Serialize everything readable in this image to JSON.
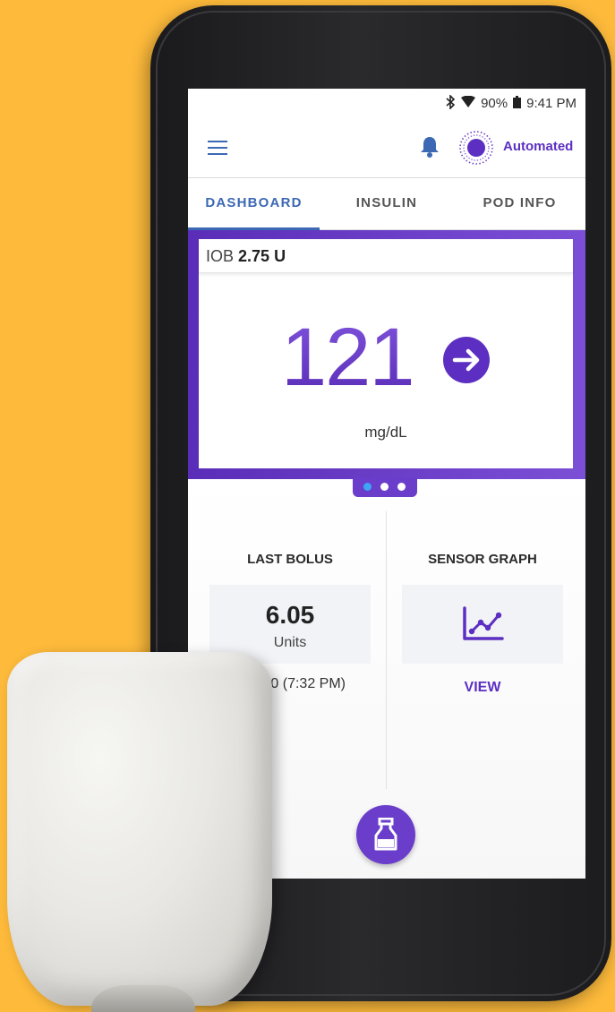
{
  "status_bar": {
    "bluetooth_icon": "bluetooth-icon",
    "wifi_icon": "wifi-icon",
    "battery_percent": "90%",
    "battery_icon": "battery-icon",
    "time": "9:41 PM"
  },
  "app_bar": {
    "menu_icon": "hamburger-menu-icon",
    "notification_icon": "bell-icon",
    "mode_icon": "automated-mode-icon",
    "mode_label": "Automated"
  },
  "tabs": [
    {
      "label": "DASHBOARD",
      "active": true
    },
    {
      "label": "INSULIN",
      "active": false
    },
    {
      "label": "POD INFO",
      "active": false
    }
  ],
  "iob": {
    "label": "IOB",
    "value": "2.75 U"
  },
  "glucose": {
    "value": "121",
    "unit": "mg/dL",
    "trend_icon": "trend-arrow-right-icon"
  },
  "pager": {
    "count": 3,
    "active_index": 0
  },
  "last_bolus": {
    "title": "LAST BOLUS",
    "value": "6.05",
    "unit": "Units",
    "time": "0 (7:32 PM)"
  },
  "sensor_graph": {
    "title": "SENSOR GRAPH",
    "icon": "line-chart-icon",
    "link": "VIEW"
  },
  "fab": {
    "icon": "bolus-vial-icon"
  },
  "colors": {
    "background": "#FDBA3B",
    "primary_purple": "#6A3DCB",
    "accent_blue": "#3C68B4",
    "text_purple": "#5C2FC2"
  }
}
